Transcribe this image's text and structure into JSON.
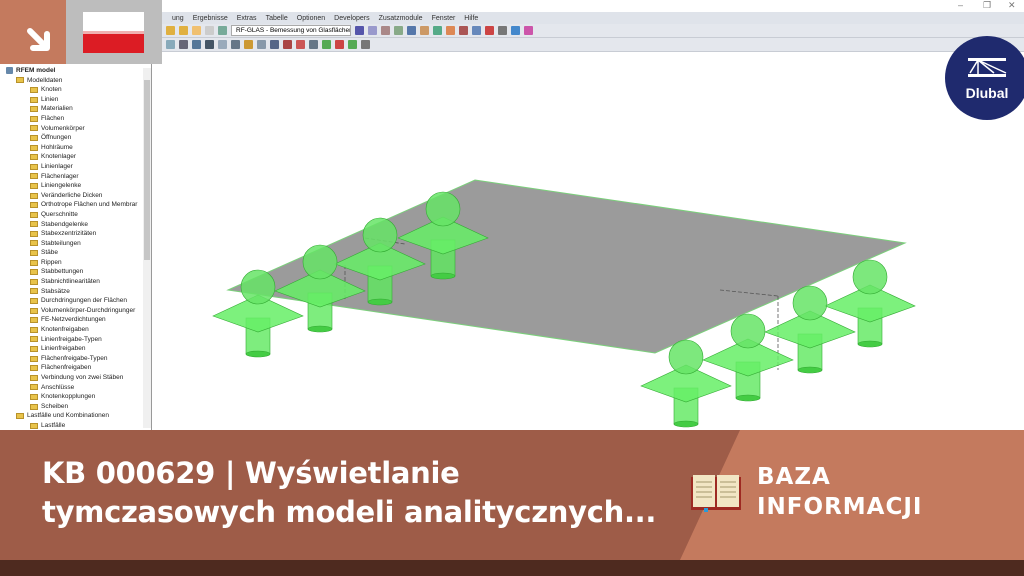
{
  "window": {
    "minimize": "–",
    "restore": "❐",
    "close": "✕"
  },
  "menu": [
    "ung",
    "Ergebnisse",
    "Extras",
    "Tabelle",
    "Optionen",
    "Developers",
    "Zusatzmodule",
    "Fenster",
    "Hilfe"
  ],
  "toolbar": {
    "module_combo": "RF-GLAS - Bemessung von Glasflächen"
  },
  "tree": {
    "root": "RFEM model",
    "items": [
      {
        "label": "Modelldaten",
        "level": 1
      },
      {
        "label": "Knoten",
        "level": 2
      },
      {
        "label": "Linien",
        "level": 2
      },
      {
        "label": "Materialien",
        "level": 2
      },
      {
        "label": "Flächen",
        "level": 2
      },
      {
        "label": "Volumenkörper",
        "level": 2
      },
      {
        "label": "Öffnungen",
        "level": 2
      },
      {
        "label": "Hohlräume",
        "level": 2
      },
      {
        "label": "Knotenlager",
        "level": 2
      },
      {
        "label": "Linienlager",
        "level": 2
      },
      {
        "label": "Flächenlager",
        "level": 2
      },
      {
        "label": "Liniengelenke",
        "level": 2
      },
      {
        "label": "Veränderliche Dicken",
        "level": 2
      },
      {
        "label": "Orthotrope Flächen und Membrar",
        "level": 2
      },
      {
        "label": "Querschnitte",
        "level": 2
      },
      {
        "label": "Stabendgelenke",
        "level": 2
      },
      {
        "label": "Stabexzentrizitäten",
        "level": 2
      },
      {
        "label": "Stabteilungen",
        "level": 2
      },
      {
        "label": "Stäbe",
        "level": 2
      },
      {
        "label": "Rippen",
        "level": 2
      },
      {
        "label": "Stabbettungen",
        "level": 2
      },
      {
        "label": "Stabnichtlinearitäten",
        "level": 2
      },
      {
        "label": "Stabsätze",
        "level": 2
      },
      {
        "label": "Durchdringungen der Flächen",
        "level": 2
      },
      {
        "label": "Volumenkörper-Durchdringunger",
        "level": 2
      },
      {
        "label": "FE-Netzverdichtungen",
        "level": 2
      },
      {
        "label": "Knotenfreigaben",
        "level": 2
      },
      {
        "label": "Linienfreigabe-Typen",
        "level": 2
      },
      {
        "label": "Linienfreigaben",
        "level": 2
      },
      {
        "label": "Flächenfreigabe-Typen",
        "level": 2
      },
      {
        "label": "Flächenfreigaben",
        "level": 2
      },
      {
        "label": "Verbindung von zwei Stäben",
        "level": 2
      },
      {
        "label": "Anschlüsse",
        "level": 2
      },
      {
        "label": "Knotenkopplungen",
        "level": 2
      },
      {
        "label": "Scheiben",
        "level": 2
      },
      {
        "label": "Lastfälle und Kombinationen",
        "level": 1
      },
      {
        "label": "Lastfälle",
        "level": 2
      }
    ]
  },
  "logo": {
    "text": "Dlubal"
  },
  "banner": {
    "title_line1": "KB 000629 | Wyświetlanie",
    "title_line2": "tymczasowych modeli analitycznych...",
    "category_line1": "BAZA",
    "category_line2": "INFORMACJI"
  },
  "colors": {
    "banner_dark": "#9e5c48",
    "banner_light": "#c47a5e",
    "strip": "#4e2a1f",
    "support_green": "#5ee85e",
    "logo_blue": "#1f2a6e",
    "flag_red": "#dc1c24"
  }
}
